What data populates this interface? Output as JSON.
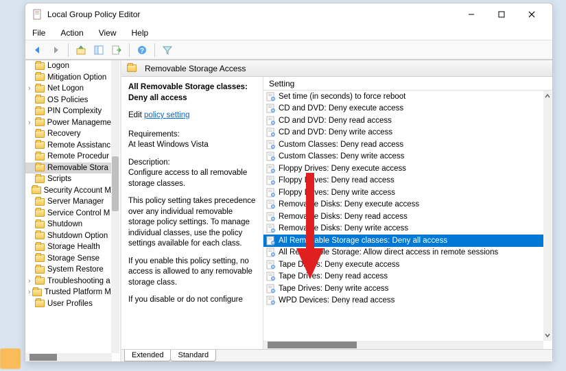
{
  "window": {
    "title": "Local Group Policy Editor"
  },
  "menu": {
    "file": "File",
    "action": "Action",
    "view": "View",
    "help": "Help"
  },
  "tree": {
    "items": [
      {
        "label": "Logon",
        "exp": false
      },
      {
        "label": "Mitigation Option",
        "exp": false
      },
      {
        "label": "Net Logon",
        "exp": true
      },
      {
        "label": "OS Policies",
        "exp": false
      },
      {
        "label": "PIN Complexity",
        "exp": false
      },
      {
        "label": "Power Manageme",
        "exp": true
      },
      {
        "label": "Recovery",
        "exp": false
      },
      {
        "label": "Remote Assistanc",
        "exp": false
      },
      {
        "label": "Remote Procedur",
        "exp": false
      },
      {
        "label": "Removable Stora",
        "exp": false,
        "selected": true
      },
      {
        "label": "Scripts",
        "exp": false
      },
      {
        "label": "Security Account M",
        "exp": false
      },
      {
        "label": "Server Manager",
        "exp": false
      },
      {
        "label": "Service Control M",
        "exp": false
      },
      {
        "label": "Shutdown",
        "exp": false
      },
      {
        "label": "Shutdown Option",
        "exp": false
      },
      {
        "label": "Storage Health",
        "exp": false
      },
      {
        "label": "Storage Sense",
        "exp": false
      },
      {
        "label": "System Restore",
        "exp": false
      },
      {
        "label": "Troubleshooting a",
        "exp": true
      },
      {
        "label": "Trusted Platform M",
        "exp": true
      },
      {
        "label": "User Profiles",
        "exp": false
      }
    ]
  },
  "header": {
    "title": "Removable Storage Access"
  },
  "detail": {
    "title": "All Removable Storage classes: Deny all access",
    "edit_label": "Edit",
    "edit_link": "policy setting ",
    "req_label": "Requirements:",
    "req_text": "At least Windows Vista",
    "desc_label": "Description:",
    "desc_text": "Configure access to all removable storage classes.",
    "p2": "This policy setting takes precedence over any individual removable storage policy settings. To manage individual classes, use the policy settings available for each class.",
    "p3": "If you enable this policy setting, no access is allowed to any removable storage class.",
    "p4": "If you disable or do not configure"
  },
  "list": {
    "header": "Setting",
    "items": [
      "Set time (in seconds) to force reboot",
      "CD and DVD: Deny execute access",
      "CD and DVD: Deny read access",
      "CD and DVD: Deny write access",
      "Custom Classes: Deny read access",
      "Custom Classes: Deny write access",
      "Floppy Drives: Deny execute access",
      "Floppy Drives: Deny read access",
      "Floppy Drives: Deny write access",
      "Removable Disks: Deny execute access",
      "Removable Disks: Deny read access",
      "Removable Disks: Deny write access",
      "All Removable Storage classes: Deny all access",
      "All Removable Storage: Allow direct access in remote sessions",
      "Tape Drives: Deny execute access",
      "Tape Drives: Deny read access",
      "Tape Drives: Deny write access",
      "WPD Devices: Deny read access"
    ],
    "selected_index": 12
  },
  "tabs": {
    "extended": "Extended",
    "standard": "Standard"
  }
}
